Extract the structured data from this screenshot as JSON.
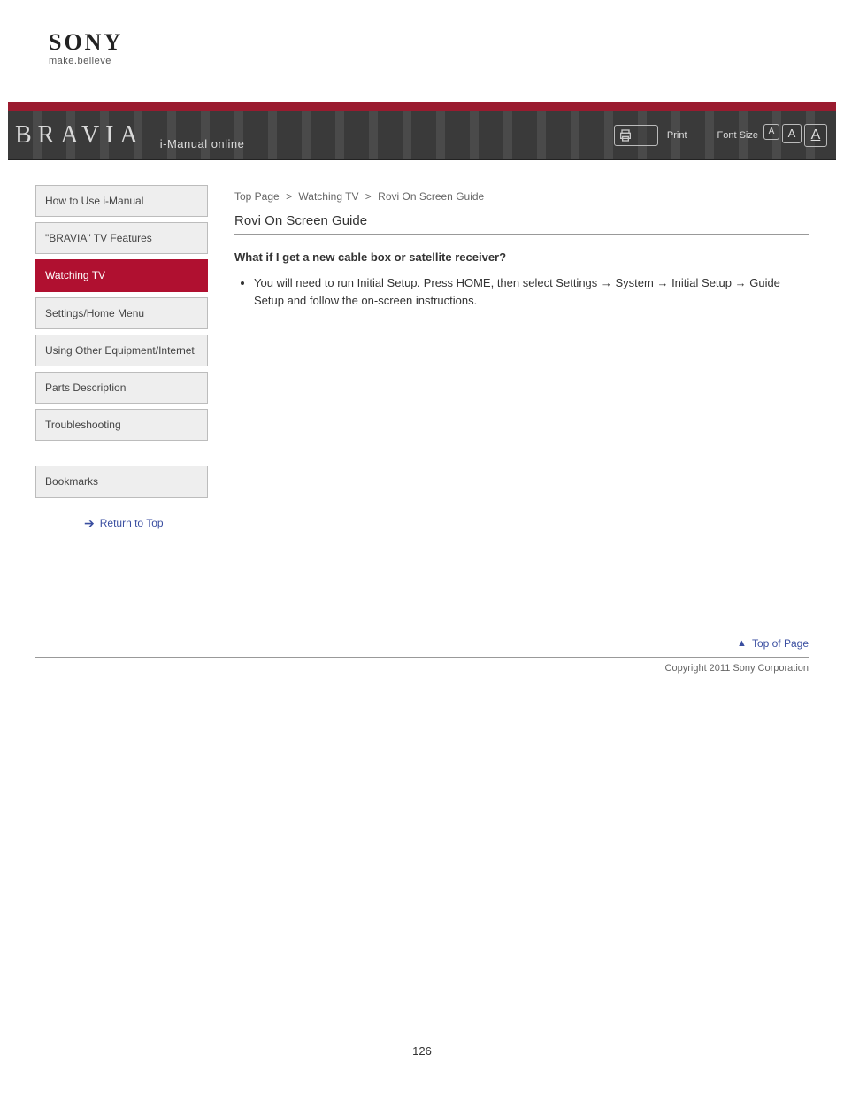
{
  "logo": {
    "brand": "SONY",
    "tagline": "make.believe"
  },
  "header": {
    "product": "BRAVIA",
    "manual_label": "i-Manual online",
    "print_label": "Print",
    "font_label": "Font Size",
    "font_a": "A"
  },
  "nav": {
    "items": [
      {
        "label": "How to Use i-Manual",
        "active": false
      },
      {
        "label": "\"BRAVIA\" TV Features",
        "active": false
      },
      {
        "label": "Watching TV",
        "active": true
      },
      {
        "label": "Settings/Home Menu",
        "active": false
      },
      {
        "label": "Using Other Equipment/Internet",
        "active": false
      },
      {
        "label": "Parts Description",
        "active": false
      },
      {
        "label": "Troubleshooting",
        "active": false
      },
      {
        "label": "Bookmarks",
        "active": false
      }
    ],
    "bookmarks_link": "Return to Top"
  },
  "content": {
    "breadcrumb": [
      "Top Page",
      "Watching TV",
      "Rovi On Screen Guide"
    ],
    "title": "Rovi On Screen Guide",
    "question": "What if I get a new cable box or satellite receiver?",
    "bullets": [
      "You will need to run Initial Setup. Press HOME, then select Settings → System → Initial Setup → Guide Setup and follow the on-screen instructions."
    ]
  },
  "footer": {
    "top_link": "Top of Page",
    "copyright": "Copyright 2011 Sony Corporation"
  },
  "page_number": "126"
}
